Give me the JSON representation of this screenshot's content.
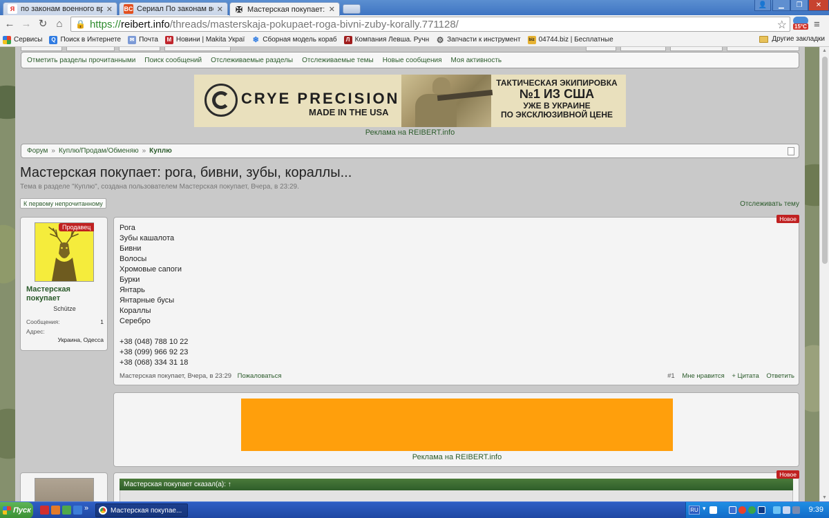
{
  "browser": {
    "tabs": [
      {
        "label": "по законам военного време",
        "favicon": "Я",
        "active": false
      },
      {
        "label": "Сериал По законам вое",
        "favicon": "BC",
        "active": false
      },
      {
        "label": "Мастерская покупает: рога",
        "favicon": "✠",
        "active": true
      }
    ],
    "url": {
      "scheme": "https://",
      "host": "reibert.info",
      "path": "/threads/masterskaja-pokupaet-roga-bivni-zuby-korally.771128/"
    },
    "weather_temp": "15°C",
    "bookmarks": [
      {
        "label": "Сервисы",
        "icon": "apps-icon"
      },
      {
        "label": "Поиск в Интернете",
        "icon": "search-icon"
      },
      {
        "label": "Почта",
        "icon": "mail-icon"
      },
      {
        "label": "Новини | Makita Украї",
        "icon": "makita-icon"
      },
      {
        "label": "Сборная модель кораб",
        "icon": "snowflake-icon"
      },
      {
        "label": "Компания Левша. Ручн",
        "icon": "company-icon"
      },
      {
        "label": "Запчасти к инструмент",
        "icon": "gear-icon"
      },
      {
        "label": "04744.biz | Бесплатные",
        "icon": "biz-icon"
      }
    ],
    "other_bookmarks": "Другие закладки"
  },
  "forum": {
    "subnav": [
      "Отметить разделы прочитанными",
      "Поиск сообщений",
      "Отслеживаемые разделы",
      "Отслеживаемые темы",
      "Новые сообщения",
      "Моя активность"
    ],
    "banner": {
      "brand": "CRYE PRECISION",
      "made": "MADE IN THE USA",
      "slogan_1": "ТАКТИЧЕСКАЯ ЭКИПИРОВКА",
      "slogan_2": "№1 ИЗ США",
      "slogan_3": "УЖЕ В УКРАИНЕ",
      "slogan_4": "ПО ЭКСКЛЮЗИВНОЙ ЦЕНЕ"
    },
    "ad_caption": "Реклама на REIBERT.info",
    "breadcrumb": {
      "items": [
        "Форум",
        "Куплю/Продам/Обменяю"
      ],
      "current": "Куплю"
    },
    "thread": {
      "title": "Мастерская покупает: рога, бивни, зубы, кораллы...",
      "description": "Тема в разделе \"Куплю\", создана пользователем Мастерская покупает, Вчера, в 23:29.",
      "first_unread": "К первому непрочитанному",
      "watch": "Отслеживать тему"
    },
    "user": {
      "badge": "Продавец",
      "name": "Мастерская покупает",
      "title": "Schütze",
      "messages_label": "Сообщения:",
      "messages_value": "1",
      "address_label": "Адрес:",
      "address_value": "Украина, Одесса"
    },
    "post": {
      "new_badge": "Новое",
      "lines": [
        "Рога",
        "Зубы кашалота",
        "Бивни",
        "Волосы",
        "Хромовые сапоги",
        "Бурки",
        "Янтарь",
        "Янтарные бусы",
        "Кораллы",
        "Серебро",
        "",
        "+38 (048) 788 10 22",
        "+38 (099) 966 92 23",
        "+38 (068) 334 31 18"
      ],
      "meta": "Мастерская покупает, Вчера, в 23:29",
      "report": "Пожаловаться",
      "number": "#1",
      "like": "Мне нравится",
      "quote": "+ Цитата",
      "reply": "Ответить"
    },
    "quote_header": "Мастерская покупает сказал(а): ↑"
  },
  "taskbar": {
    "start": "Пуск",
    "window": "Мастерская покупае...",
    "lang": "RU",
    "clock": "9:39"
  }
}
